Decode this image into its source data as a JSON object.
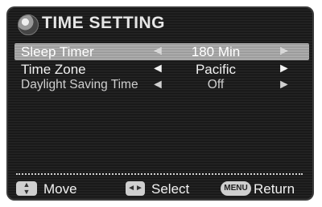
{
  "header": {
    "title": "TIME SETTING",
    "icon": "globe-icon"
  },
  "rows": [
    {
      "label": "Sleep Timer",
      "left_arrow": "◄",
      "value": "180 Min",
      "right_arrow": "►",
      "selected": true
    },
    {
      "label": "Time Zone",
      "left_arrow": "◄",
      "value": "Pacific",
      "right_arrow": "►",
      "selected": false
    },
    {
      "label": "Daylight Saving Time",
      "left_arrow": "◄",
      "value": "Off",
      "right_arrow": "►",
      "selected": false
    }
  ],
  "footer": {
    "move_icon": "▲\n▼",
    "move_label": "Move",
    "select_icon": "◄►",
    "select_label": "Select",
    "menu_icon": "MENU",
    "return_label": "Return"
  }
}
